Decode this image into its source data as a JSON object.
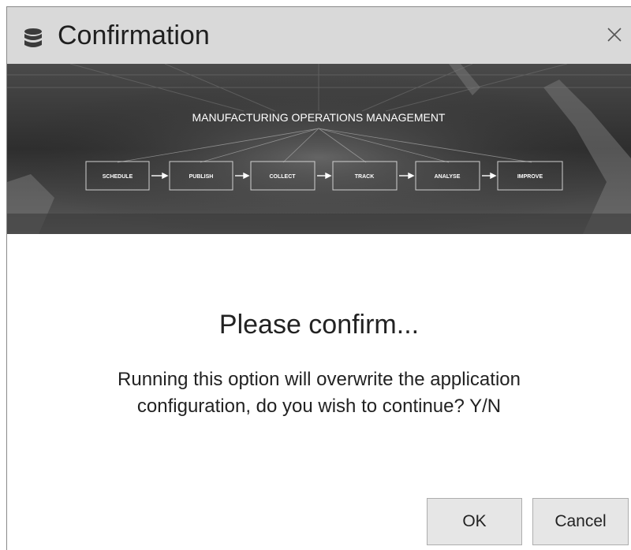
{
  "dialog": {
    "title": "Confirmation",
    "title_icon": "database-icon",
    "close_icon": "close-icon"
  },
  "banner": {
    "heading": "MANUFACTURING OPERATIONS MANAGEMENT",
    "steps": [
      "SCHEDULE",
      "PUBLISH",
      "COLLECT",
      "TRACK",
      "ANALYSE",
      "IMPROVE"
    ]
  },
  "message": {
    "title": "Please confirm...",
    "line1": "Running this option will overwrite the application",
    "line2": "configuration, do you wish to continue? Y/N"
  },
  "buttons": {
    "ok_label": "OK",
    "cancel_label": "Cancel"
  },
  "colors": {
    "titlebar": "#d9d9d9",
    "button_bg": "#e6e6e6",
    "button_border": "#adadad"
  }
}
